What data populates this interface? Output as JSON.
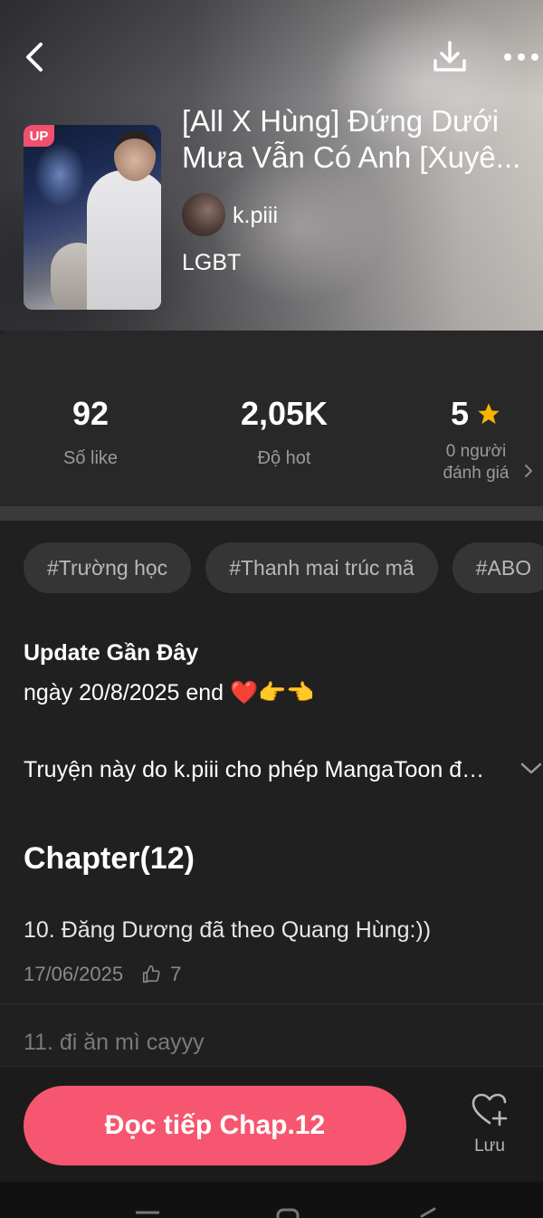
{
  "header": {
    "title_lines": [
      "[All X Hùng] Đứng Dưới",
      "Mưa Vẫn Có Anh [Xuyê..."
    ],
    "badge": "UP",
    "author": "k.piii",
    "genre": "LGBT",
    "icons": {
      "back": "back-arrow-icon",
      "download": "download-icon",
      "more": "more-dots-icon"
    }
  },
  "stats": {
    "likes": {
      "value": "92",
      "label": "Số like"
    },
    "hot": {
      "value": "2,05K",
      "label": "Độ hot"
    },
    "rating": {
      "value": "5",
      "label_line1": "0 người",
      "label_line2": "đánh giá"
    }
  },
  "tags": [
    "#Trường học",
    "#Thanh mai trúc mã",
    "#ABO"
  ],
  "update": {
    "title": "Update Gần Đây",
    "text": "ngày 20/8/2025 end ❤️👉👈"
  },
  "permission_text": "Truyện này do k.piii  cho phép MangaToon đăng tải",
  "chapters": {
    "header": "Chapter(12)",
    "items": [
      {
        "title": "10. Đăng Dương đã theo Quang Hùng:))",
        "date": "17/06/2025",
        "likes": "7"
      },
      {
        "title": "11. đi ăn mì cayyy"
      }
    ]
  },
  "bottom": {
    "continue_label": "Đọc tiếp Chap.12",
    "save_label": "Lưu"
  },
  "colors": {
    "accent": "#f6566f",
    "star": "#f7b500",
    "badge": "#f0506e",
    "background": "#202020"
  }
}
